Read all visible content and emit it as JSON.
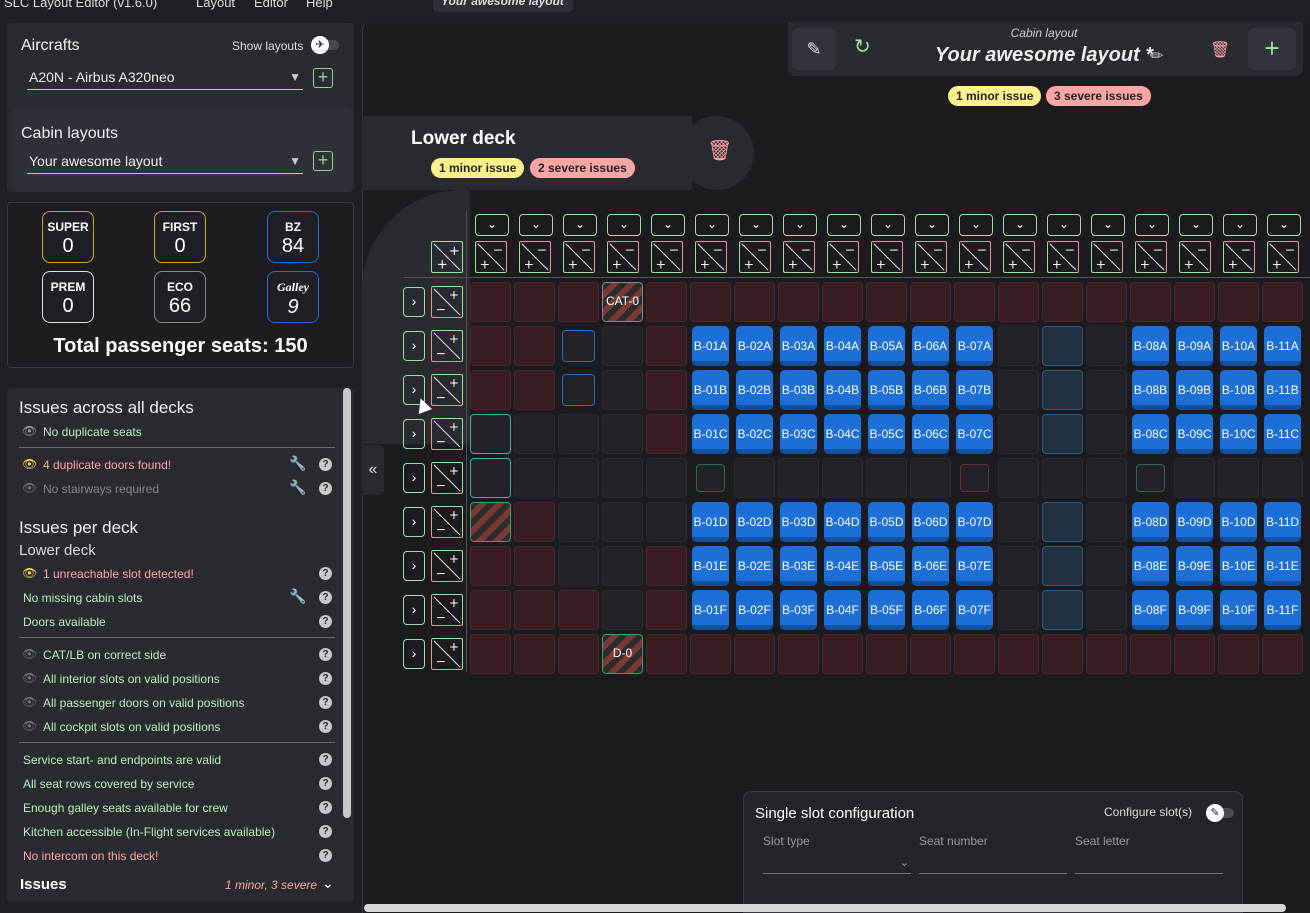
{
  "menubar": {
    "app_title": "SLC Layout Editor (v1.6.0)",
    "items": [
      "Layout",
      "Editor",
      "Help"
    ],
    "active_tab": "Your awesome layout"
  },
  "aircraft": {
    "label": "Aircrafts",
    "show_layouts": "Show layouts",
    "selected": "A20N - Airbus A320neo"
  },
  "cabin_layouts": {
    "label": "Cabin layouts",
    "selected": "Your awesome layout"
  },
  "stats": [
    {
      "label": "SUPER",
      "value": "0",
      "color": "#c8a21a"
    },
    {
      "label": "FIRST",
      "value": "0",
      "color": "#c8a21a"
    },
    {
      "label": "BZ",
      "value": "84",
      "color": "#1b6fd6"
    },
    {
      "label": "PREM",
      "value": "0",
      "color": "#e0e0e0"
    },
    {
      "label": "ECO",
      "value": "66",
      "color": "#8a8a8a"
    },
    {
      "label": "Galley",
      "value": "9",
      "color": "#1b6fd6"
    }
  ],
  "total_seats": "Total passenger seats: 150",
  "issues": {
    "title_all": "Issues across all decks",
    "no_duplicate_seats": "No duplicate seats",
    "duplicate_doors": "4 duplicate doors found!",
    "no_stairways": "No stairways required",
    "title_per_deck": "Issues per deck",
    "deck_name": "Lower deck",
    "unreachable": "1 unreachable slot detected!",
    "no_missing": "No missing cabin slots",
    "doors_available": "Doors available",
    "cat_lb": "CAT/LB on correct side",
    "interior_valid": "All interior slots on valid positions",
    "pax_doors_valid": "All passenger doors on valid positions",
    "cockpit_valid": "All cockpit slots on valid positions",
    "service_valid": "Service start- and endpoints are valid",
    "rows_covered": "All seat rows covered by service",
    "galley_enough": "Enough galley seats available for crew",
    "kitchen": "Kitchen accessible (In-Flight services available)",
    "intercom": "No intercom on this deck!",
    "footer_label": "Issues",
    "footer_summary": "1 minor, 3 severe"
  },
  "header": {
    "subtitle": "Cabin layout",
    "title": "Your awesome layout *",
    "minor": "1 minor issue",
    "severe": "3 severe issues"
  },
  "deck": {
    "title": "Lower deck",
    "minor": "1 minor issue",
    "severe": "2 severe issues"
  },
  "special_slots": {
    "cat": "CAT-0",
    "door": "D-0"
  },
  "seat_rows": {
    "A": [
      "B-01A",
      "B-02A",
      "B-03A",
      "B-04A",
      "B-05A",
      "B-06A",
      "B-07A",
      "B-08A",
      "B-09A",
      "B-10A",
      "B-11A"
    ],
    "B": [
      "B-01B",
      "B-02B",
      "B-03B",
      "B-04B",
      "B-05B",
      "B-06B",
      "B-07B",
      "B-08B",
      "B-09B",
      "B-10B",
      "B-11B"
    ],
    "C": [
      "B-01C",
      "B-02C",
      "B-03C",
      "B-04C",
      "B-05C",
      "B-06C",
      "B-07C",
      "B-08C",
      "B-09C",
      "B-10C",
      "B-11C"
    ],
    "D": [
      "B-01D",
      "B-02D",
      "B-03D",
      "B-04D",
      "B-05D",
      "B-06D",
      "B-07D",
      "B-08D",
      "B-09D",
      "B-10D",
      "B-11D"
    ],
    "E": [
      "B-01E",
      "B-02E",
      "B-03E",
      "B-04E",
      "B-05E",
      "B-06E",
      "B-07E",
      "B-08E",
      "B-09E",
      "B-10E",
      "B-11E"
    ],
    "F": [
      "B-01F",
      "B-02F",
      "B-03F",
      "B-04F",
      "B-05F",
      "B-06F",
      "B-07F",
      "B-08F",
      "B-09F",
      "B-10F",
      "B-11F"
    ]
  },
  "slot_config": {
    "title": "Single slot configuration",
    "configure": "Configure slot(s)",
    "slot_type": "Slot type",
    "seat_number": "Seat number",
    "seat_letter": "Seat letter"
  },
  "colors": {
    "accent_green": "#9be39b",
    "seat_blue": "#1b6fd6",
    "minor_yellow": "#fef08a",
    "severe_red": "#fca5a5"
  }
}
